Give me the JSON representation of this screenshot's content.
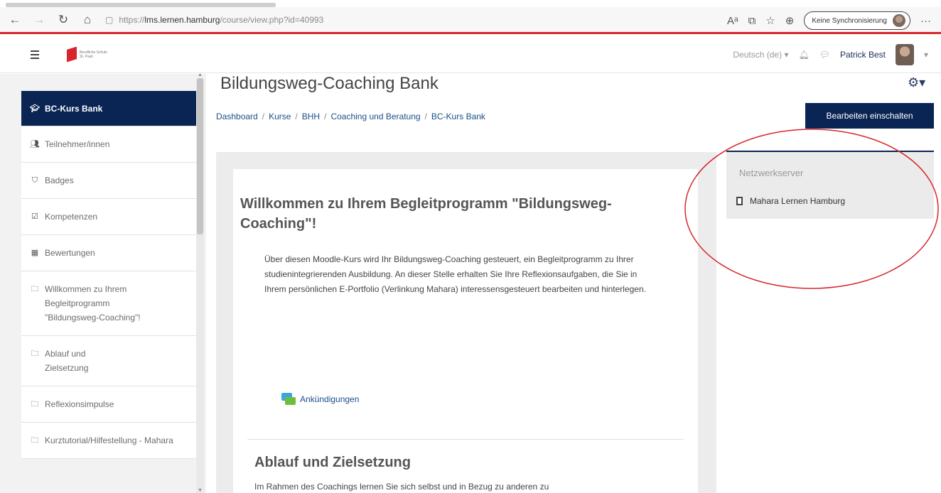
{
  "browser": {
    "url_prefix": "https://",
    "url_host": "lms.lernen.hamburg",
    "url_path": "/course/view.php?id=40993",
    "sync_label": "Keine Synchronisierung",
    "more": "···"
  },
  "navbar": {
    "logo_text_line1": "Berufliche Schule",
    "logo_text_line2": "St. Pauli",
    "language": "Deutsch (de)",
    "user_name": "Patrick Best"
  },
  "drawer": {
    "items": [
      {
        "label": "BC-Kurs Bank",
        "icon": "graduation-cap-icon"
      },
      {
        "label": "Teilnehmer/innen",
        "icon": "users-icon"
      },
      {
        "label": "Badges",
        "icon": "shield-icon"
      },
      {
        "label": "Kompetenzen",
        "icon": "checkbox-icon"
      },
      {
        "label": "Bewertungen",
        "icon": "table-icon"
      },
      {
        "label": "Willkommen zu Ihrem Begleitprogramm \"Bildungsweg-Coaching\"!",
        "icon": "folder-icon"
      },
      {
        "label": "Ablauf und Zielsetzung",
        "icon": "folder-icon"
      },
      {
        "label": "Reflexionsimpulse",
        "icon": "folder-icon"
      },
      {
        "label": "Kurztutorial/Hilfestellung - Mahara",
        "icon": "folder-icon"
      }
    ]
  },
  "page": {
    "title": "Bildungsweg-Coaching Bank",
    "breadcrumb": [
      "Dashboard",
      "Kurse",
      "BHH",
      "Coaching und Beratung",
      "BC-Kurs Bank"
    ],
    "edit_button": "Bearbeiten einschalten"
  },
  "course": {
    "section1_title": "Willkommen zu Ihrem Begleitprogramm \"Bildungsweg-Coaching\"!",
    "section1_summary": "Über diesen Moodle-Kurs wird Ihr Bildungsweg-Coaching gesteuert, ein Begleitprogramm zu Ihrer studienintegrierenden Ausbildung. An dieser Stelle erhalten Sie Ihre Reflexionsaufgaben, die Sie in Ihrem persönlichen E-Portfolio (Verlinkung Mahara) interessensgesteuert bearbeiten und hinterlegen.",
    "forum_label": "Ankündigungen",
    "section2_title": "Ablauf und Zielsetzung",
    "section2_text": "Im Rahmen des Coachings lernen Sie sich selbst und in Bezug zu anderen zu"
  },
  "block": {
    "title": "Netzwerkserver",
    "item": "Mahara Lernen Hamburg"
  },
  "colors": {
    "brand_dark": "#0a2554",
    "accent_red": "#d7262b",
    "link": "#1a4f88"
  }
}
